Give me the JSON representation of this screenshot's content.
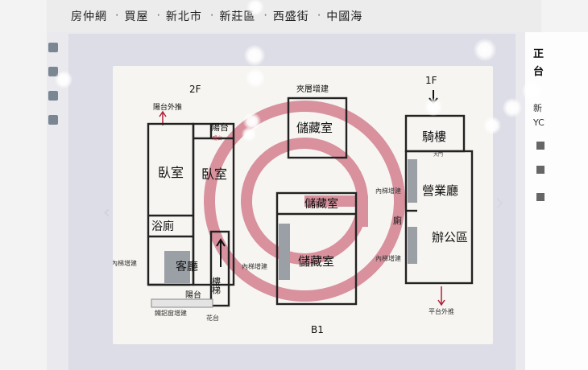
{
  "breadcrumb": [
    "房仲網",
    "買屋",
    "新北市",
    "新莊區",
    "西盛街",
    "中國海"
  ],
  "breadcrumb_separator": "‧",
  "floorplan": {
    "floor_2f": "2F",
    "floor_1f": "1F",
    "floor_b1": "B1",
    "mezzanine": "夾層增建",
    "rooms": {
      "bedroom_left": "臥室",
      "bedroom_right": "臥室",
      "bathroom": "浴廁",
      "living_room": "客廳",
      "stairs": "樓梯",
      "balcony_top": "陽台",
      "balcony_bottom": "陽台",
      "storage_mezz": "儲藏室",
      "storage_b1_top": "儲藏室",
      "storage_b1_main": "儲藏室",
      "arcade": "騎樓",
      "business_hall": "營業廳",
      "office": "辦公區",
      "restroom": "廁"
    },
    "notes": {
      "balcony_out": "陽台外推",
      "aluminum_window": "鐵鋁窗增建",
      "inner_stair_2f": "內梯增建",
      "inner_stair_b1": "內梯增建",
      "inner_stair_1f_top": "內梯增建",
      "inner_stair_1f_bottom": "內梯增建",
      "flower_bed": "花台",
      "platform_out": "平台外推",
      "door_label": "大門",
      "window_label": "陽台"
    }
  },
  "right_panel": {
    "title_1": "正",
    "title_2": "台",
    "line_1": "新",
    "line_2": "YC"
  },
  "nav": {
    "next": "›",
    "prev": "‹"
  },
  "colors": {
    "accent_watermark": "#c0405a",
    "wall": "#222222",
    "note_red": "#b0203a"
  }
}
